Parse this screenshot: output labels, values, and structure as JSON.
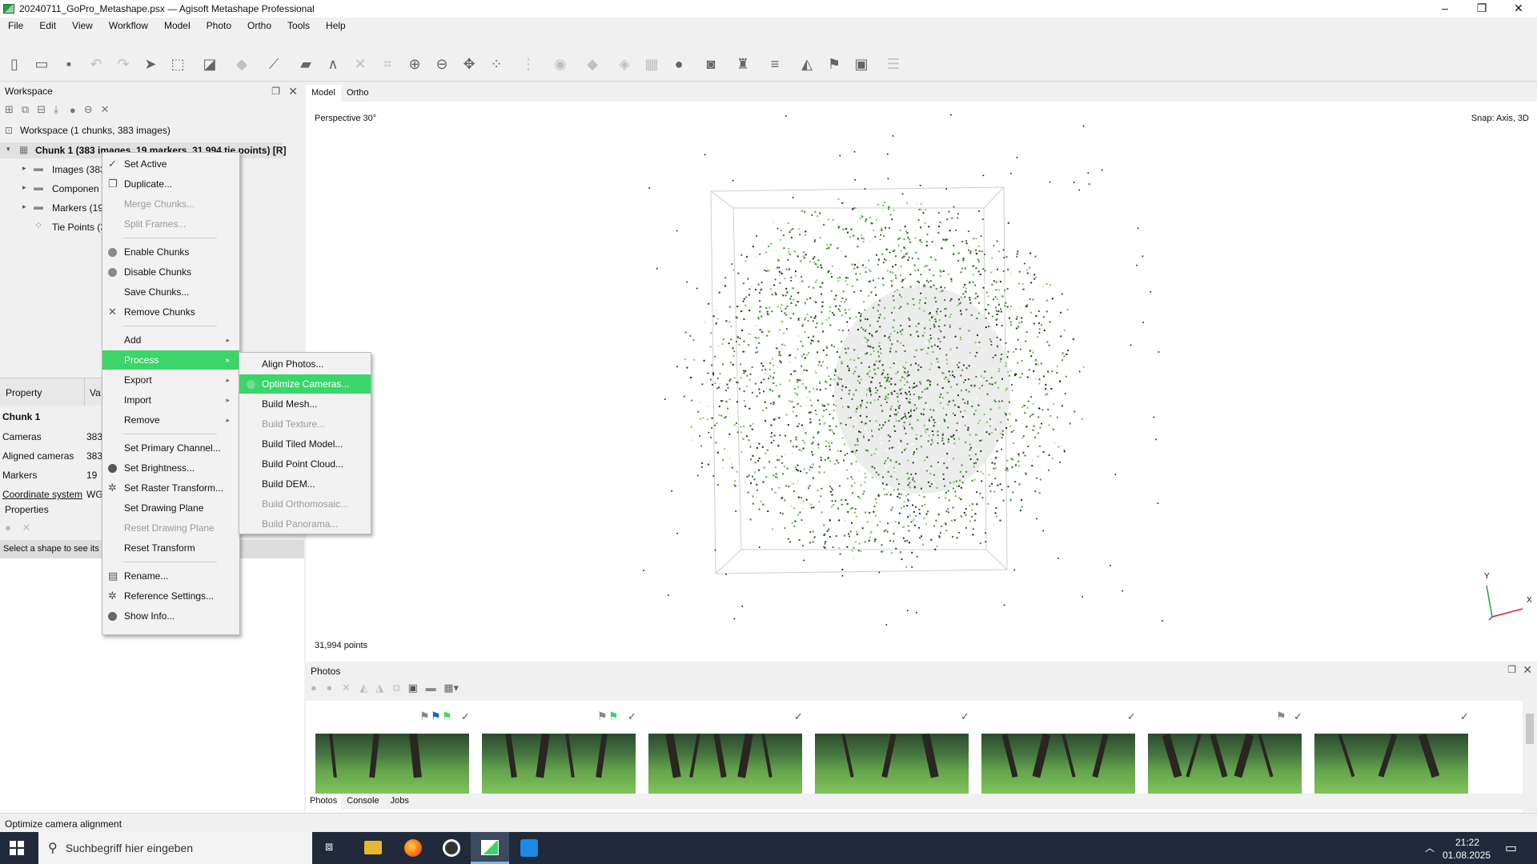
{
  "window": {
    "title": "20240711_GoPro_Metashape.psx — Agisoft Metashape Professional",
    "minimize": "–",
    "maximize": "❐",
    "close": "✕"
  },
  "menu": [
    "File",
    "Edit",
    "View",
    "Workflow",
    "Model",
    "Photo",
    "Ortho",
    "Tools",
    "Help"
  ],
  "workspace": {
    "panel_title": "Workspace",
    "root": "Workspace (1 chunks, 383 images)",
    "chunk": "Chunk 1 (383 images, 19 markers, 31,994 tie points) [R]",
    "children": [
      "Images (383",
      "Componen",
      "Markers (19",
      "Tie Points (3"
    ]
  },
  "properties": {
    "col_property": "Property",
    "col_value": "Va",
    "section": "Chunk 1",
    "rows": [
      {
        "name": "Cameras",
        "value": "383"
      },
      {
        "name": "Aligned cameras",
        "value": "383"
      },
      {
        "name": "Markers",
        "value": "19"
      },
      {
        "name": "Coordinate system",
        "value": "WG"
      }
    ],
    "panel_title": "Properties",
    "hint": "Select a shape to see its p"
  },
  "context_menu": {
    "items": [
      "Set Active",
      "Duplicate...",
      "Merge Chunks...",
      "Split Frames...",
      "Enable Chunks",
      "Disable Chunks",
      "Save Chunks...",
      "Remove Chunks",
      "Add",
      "Process",
      "Export",
      "Import",
      "Remove",
      "Set Primary Channel...",
      "Set Brightness...",
      "Set Raster Transform...",
      "Set Drawing Plane",
      "Reset Drawing Plane",
      "Reset Transform",
      "Rename...",
      "Reference Settings...",
      "Show Info..."
    ]
  },
  "process_submenu": {
    "items": [
      "Align Photos...",
      "Optimize Cameras...",
      "Build Mesh...",
      "Build Texture...",
      "Build Tiled Model...",
      "Build Point Cloud...",
      "Build DEM...",
      "Build Orthomosaic...",
      "Build Panorama..."
    ]
  },
  "viewport": {
    "tabs": [
      "Model",
      "Ortho"
    ],
    "projection": "Perspective 30°",
    "snap": "Snap: Axis, 3D",
    "points": "31,994 points",
    "axis_y": "Y",
    "axis_x": "X"
  },
  "photos": {
    "panel_title": "Photos",
    "tabs": [
      "Photos",
      "Console",
      "Jobs"
    ]
  },
  "status_bar": "Optimize camera alignment",
  "taskbar": {
    "search_placeholder": "Suchbegriff hier eingeben",
    "time": "21:22",
    "date": "01.08.2025"
  },
  "colors": {
    "highlight": "#3ad66a",
    "taskbar": "#202a3a"
  }
}
